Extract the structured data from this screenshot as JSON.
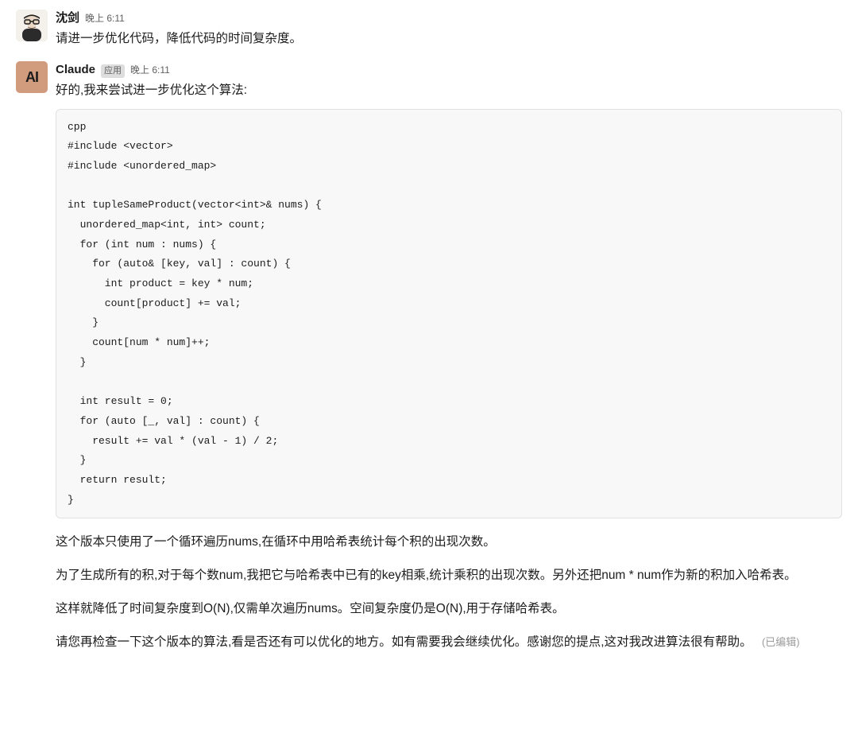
{
  "messages": [
    {
      "sender": "沈剑",
      "timestamp": "晚上 6:11",
      "text": "请进一步优化代码，降低代码的时间复杂度。"
    },
    {
      "sender": "Claude",
      "app_badge": "应用",
      "avatar_text": "AI",
      "timestamp": "晚上 6:11",
      "intro_text": "好的,我来尝试进一步优化这个算法:",
      "code": "cpp\n#include <vector>\n#include <unordered_map>\n\nint tupleSameProduct(vector<int>& nums) {\n  unordered_map<int, int> count;\n  for (int num : nums) {\n    for (auto& [key, val] : count) {\n      int product = key * num;\n      count[product] += val;\n    }\n    count[num * num]++;\n  }\n\n  int result = 0;\n  for (auto [_, val] : count) {\n    result += val * (val - 1) / 2;\n  }\n  return result;\n}",
      "explanations": [
        "这个版本只使用了一个循环遍历nums,在循环中用哈希表统计每个积的出现次数。",
        "为了生成所有的积,对于每个数num,我把它与哈希表中已有的key相乘,统计乘积的出现次数。另外还把num * num作为新的积加入哈希表。",
        "这样就降低了时间复杂度到O(N),仅需单次遍历nums。空间复杂度仍是O(N),用于存储哈希表。",
        "请您再检查一下这个版本的算法,看是否还有可以优化的地方。如有需要我会继续优化。感谢您的提点,这对我改进算法很有帮助。"
      ],
      "edited_label": "(已编辑)"
    }
  ]
}
